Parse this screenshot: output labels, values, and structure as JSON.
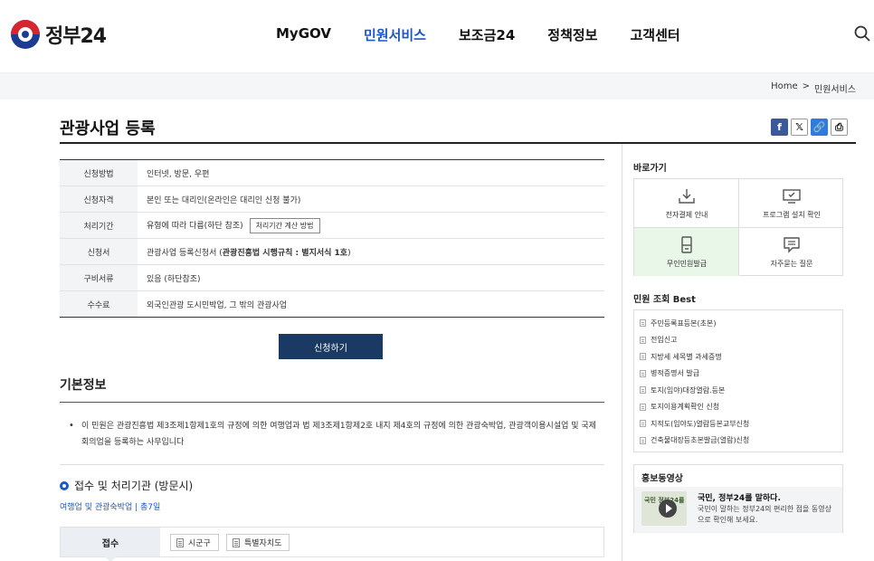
{
  "header": {
    "logo_text": "정부24",
    "nav": [
      {
        "label": "MyGOV",
        "active": false
      },
      {
        "label": "민원서비스",
        "active": true
      },
      {
        "label": "보조금24",
        "active": false
      },
      {
        "label": "정책정보",
        "active": false
      },
      {
        "label": "고객센터",
        "active": false
      }
    ],
    "accent_color": "#1a57c8"
  },
  "breadcrumb": {
    "home": "Home",
    "separator": ">",
    "current": "민원서비스"
  },
  "page": {
    "title": "관광사업 등록"
  },
  "share": {
    "facebook": "f",
    "x": "𝕏",
    "link": "🔗",
    "print": "⎙"
  },
  "info_table": {
    "rows": [
      {
        "label": "신청방법",
        "value": "인터넷, 방문, 우편"
      },
      {
        "label": "신청자격",
        "value": "본인 또는 대리인(온라인은 대리인 신청 불가)"
      },
      {
        "label": "처리기간",
        "value": "유형에 따라 다름(하단 참조)",
        "button": "처리기간 계산 방법"
      },
      {
        "label": "신청서",
        "value_prefix": "관광사업 등록신청서 (",
        "value_bold": "관광진흥법 시행규칙 : 별지서식 1호",
        "value_suffix": ")"
      },
      {
        "label": "구비서류",
        "value": "있음 (하단참조)"
      },
      {
        "label": "수수료",
        "value": "외국인관광 도시민박업, 그 밖의 관광사업"
      }
    ]
  },
  "apply_button": "신청하기",
  "basic_info": {
    "title": "기본정보",
    "text": "이 민원은 관광진흥법 제3조제1항제1호의 규정에 의한 여행업과 법 제3조제1항제2호 내지 제4호의 규정에 의한 관광숙박업, 관광객이용시설업 및 국제회의업을 등록하는 사무입니다"
  },
  "reception": {
    "title": "접수 및 처리기관 (방문시)",
    "link": "여행업 및 관광숙박업 | 총7일",
    "label": "접수",
    "options": [
      "시군구",
      "특별자치도"
    ]
  },
  "sidebar": {
    "quick_title": "바로가기",
    "quick_items": [
      {
        "label": "전자결제 안내",
        "icon": "download-icon",
        "highlight": false
      },
      {
        "label": "프로그램 설치 확인",
        "icon": "monitor-check-icon",
        "highlight": false
      },
      {
        "label": "무인민원발급",
        "icon": "kiosk-icon",
        "highlight": true
      },
      {
        "label": "자주묻는 질문",
        "icon": "chat-icon",
        "highlight": false
      }
    ],
    "best_title": "민원 조회 Best",
    "best_items": [
      "주민등록표등본(초본)",
      "전입신고",
      "지방세 세목별 과세증명",
      "병적증명서 발급",
      "토지(임야)대장열람.등본",
      "토지이용계획확인 신청",
      "지적도(임야도)열람등본교부신청",
      "건축물대장등초본발급(열람)신청"
    ],
    "promo_title": "홍보동영상",
    "promo_video_title": "국민, 정부24를 말하다.",
    "promo_video_desc": "국민이 말하는 정부24의 편리한 점을 동영상으로 확인해 보세요.",
    "promo_thumb_text": "국민 정부24를"
  }
}
